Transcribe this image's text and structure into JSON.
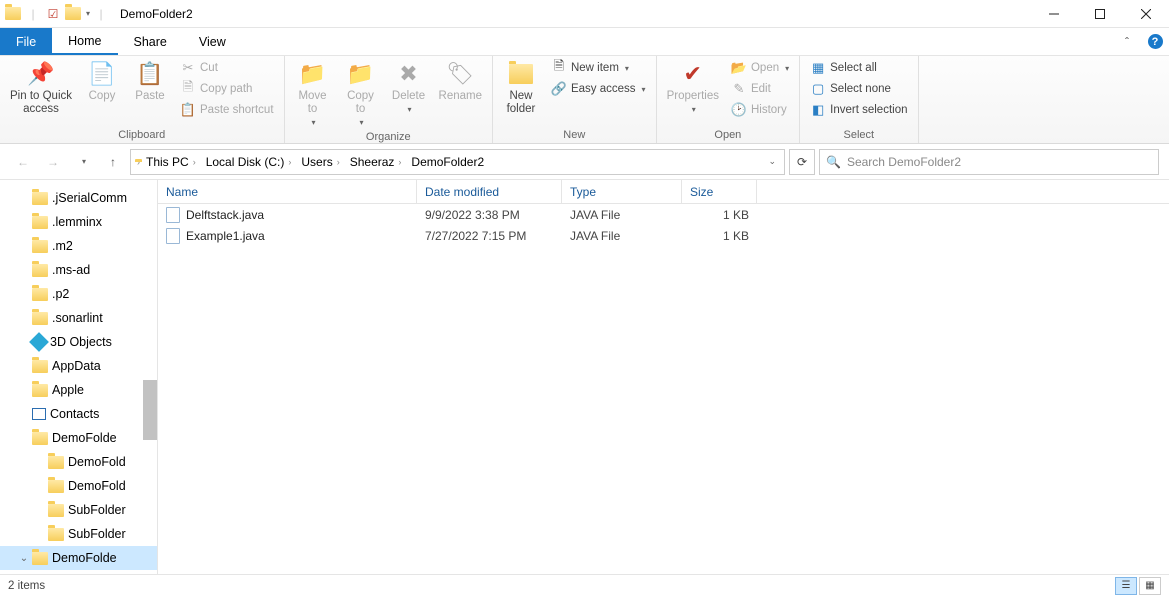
{
  "title": "DemoFolder2",
  "tabs": {
    "file": "File",
    "home": "Home",
    "share": "Share",
    "view": "View"
  },
  "ribbon": {
    "clipboard": {
      "label": "Clipboard",
      "pin": "Pin to Quick\naccess",
      "copy": "Copy",
      "paste": "Paste",
      "cut": "Cut",
      "copypath": "Copy path",
      "pasteshort": "Paste shortcut"
    },
    "organize": {
      "label": "Organize",
      "moveto": "Move\nto",
      "copyto": "Copy\nto",
      "delete": "Delete",
      "rename": "Rename"
    },
    "new": {
      "label": "New",
      "newfolder": "New\nfolder",
      "newitem": "New item",
      "easyaccess": "Easy access"
    },
    "open": {
      "label": "Open",
      "properties": "Properties",
      "open": "Open",
      "edit": "Edit",
      "history": "History"
    },
    "select": {
      "label": "Select",
      "selectall": "Select all",
      "selectnone": "Select none",
      "invert": "Invert selection"
    }
  },
  "breadcrumb": [
    "This PC",
    "Local Disk (C:)",
    "Users",
    "Sheeraz",
    "DemoFolder2"
  ],
  "search_placeholder": "Search DemoFolder2",
  "tree": [
    {
      "label": ".jSerialComm",
      "type": "folder",
      "sub": false
    },
    {
      "label": ".lemminx",
      "type": "folder",
      "sub": false
    },
    {
      "label": ".m2",
      "type": "folder",
      "sub": false
    },
    {
      "label": ".ms-ad",
      "type": "folder",
      "sub": false
    },
    {
      "label": ".p2",
      "type": "folder",
      "sub": false
    },
    {
      "label": ".sonarlint",
      "type": "folder",
      "sub": false
    },
    {
      "label": "3D Objects",
      "type": "3d",
      "sub": false
    },
    {
      "label": "AppData",
      "type": "folder",
      "sub": false
    },
    {
      "label": "Apple",
      "type": "folder",
      "sub": false
    },
    {
      "label": "Contacts",
      "type": "contacts",
      "sub": false
    },
    {
      "label": "DemoFolde",
      "type": "folder",
      "sub": false
    },
    {
      "label": "DemoFold",
      "type": "folder",
      "sub": true
    },
    {
      "label": "DemoFold",
      "type": "folder",
      "sub": true
    },
    {
      "label": "SubFolder",
      "type": "folder",
      "sub": true
    },
    {
      "label": "SubFolder",
      "type": "folder",
      "sub": true
    },
    {
      "label": "DemoFolde",
      "type": "folder",
      "sub": false,
      "selected": true,
      "expand": true
    }
  ],
  "columns": {
    "name": "Name",
    "date": "Date modified",
    "type": "Type",
    "size": "Size"
  },
  "files": [
    {
      "name": "Delftstack.java",
      "date": "9/9/2022 3:38 PM",
      "type": "JAVA File",
      "size": "1 KB"
    },
    {
      "name": "Example1.java",
      "date": "7/27/2022 7:15 PM",
      "type": "JAVA File",
      "size": "1 KB"
    }
  ],
  "status": "2 items"
}
